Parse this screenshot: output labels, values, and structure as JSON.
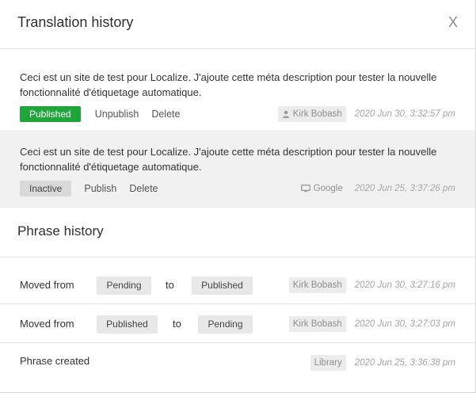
{
  "header": {
    "title": "Translation history",
    "close_label": "X"
  },
  "translations": [
    {
      "text": "Ceci est un site de test pour Localize. J'ajoute cette méta description pour tester la nouvelle fonctionnalité d'étiquetage automatique.",
      "status": "Published",
      "actions": [
        "Unpublish",
        "Delete"
      ],
      "author": "Kirk Bobash",
      "author_icon": "user-icon",
      "date": "2020 Jun 30, 3:32:57 pm"
    },
    {
      "text": "Ceci est un site de test pour Localize. J'ajoute cette méta description pour tester la nouvelle fonctionnalité d'étiquetage automatique.",
      "status": "Inactive",
      "actions": [
        "Publish",
        "Delete"
      ],
      "author": "Google",
      "author_icon": "monitor-icon",
      "date": "2020 Jun 25, 3:37:26 pm"
    }
  ],
  "phrase_history": {
    "title": "Phrase history",
    "items": [
      {
        "label": "Moved from",
        "from": "Pending",
        "to_word": "to",
        "to": "Published",
        "author": "Kirk Bobash",
        "date": "2020 Jun 30, 3:27:16 pm"
      },
      {
        "label": "Moved from",
        "from": "Published",
        "to_word": "to",
        "to": "Pending",
        "author": "Kirk Bobash",
        "date": "2020 Jun 30, 3:27:03 pm"
      },
      {
        "label": "Phrase created",
        "author": "Library",
        "date": "2020 Jun 25, 3:36:38 pm"
      }
    ]
  },
  "colors": {
    "published": "#1fa53a",
    "inactive": "#d9d9d9",
    "highlight_row": "#f1f1f1"
  }
}
